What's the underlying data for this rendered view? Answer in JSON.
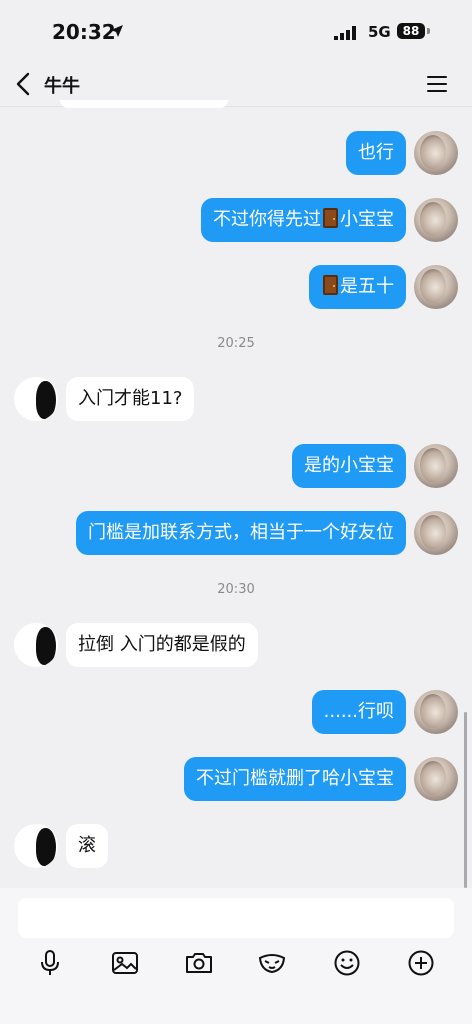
{
  "status_bar": {
    "time": "20:32",
    "network": "5G",
    "battery": "88"
  },
  "nav": {
    "title": "牛牛"
  },
  "messages": [
    {
      "from": "me",
      "parts": [
        {
          "t": "text",
          "v": "也行"
        }
      ]
    },
    {
      "from": "me",
      "parts": [
        {
          "t": "text",
          "v": "不过你得先过"
        },
        {
          "t": "door"
        },
        {
          "t": "text",
          "v": "小宝宝"
        }
      ]
    },
    {
      "from": "me",
      "parts": [
        {
          "t": "door"
        },
        {
          "t": "text",
          "v": "是五十"
        }
      ]
    },
    {
      "timestamp": "20:25"
    },
    {
      "from": "other",
      "parts": [
        {
          "t": "text",
          "v": "入门才能11?"
        }
      ]
    },
    {
      "from": "me",
      "parts": [
        {
          "t": "text",
          "v": "是的小宝宝"
        }
      ]
    },
    {
      "from": "me",
      "parts": [
        {
          "t": "text",
          "v": "门槛是加联系方式，相当于一个好友位"
        }
      ]
    },
    {
      "timestamp": "20:30"
    },
    {
      "from": "other",
      "parts": [
        {
          "t": "text",
          "v": "拉倒 入门的都是假的"
        }
      ]
    },
    {
      "from": "me",
      "parts": [
        {
          "t": "text",
          "v": "......行呗"
        }
      ]
    },
    {
      "from": "me",
      "parts": [
        {
          "t": "text",
          "v": "不过门槛就删了哈小宝宝"
        }
      ]
    },
    {
      "from": "other",
      "parts": [
        {
          "t": "text",
          "v": "滚"
        }
      ]
    }
  ],
  "input": {
    "value": "",
    "placeholder": ""
  },
  "toolbar": {
    "icons": [
      "microphone-icon",
      "image-icon",
      "camera-icon",
      "mask-icon",
      "emoji-icon",
      "plus-icon"
    ]
  },
  "colors": {
    "my_bubble": "#1f9bf5",
    "other_bubble": "#ffffff",
    "background": "#f0f0f3"
  }
}
